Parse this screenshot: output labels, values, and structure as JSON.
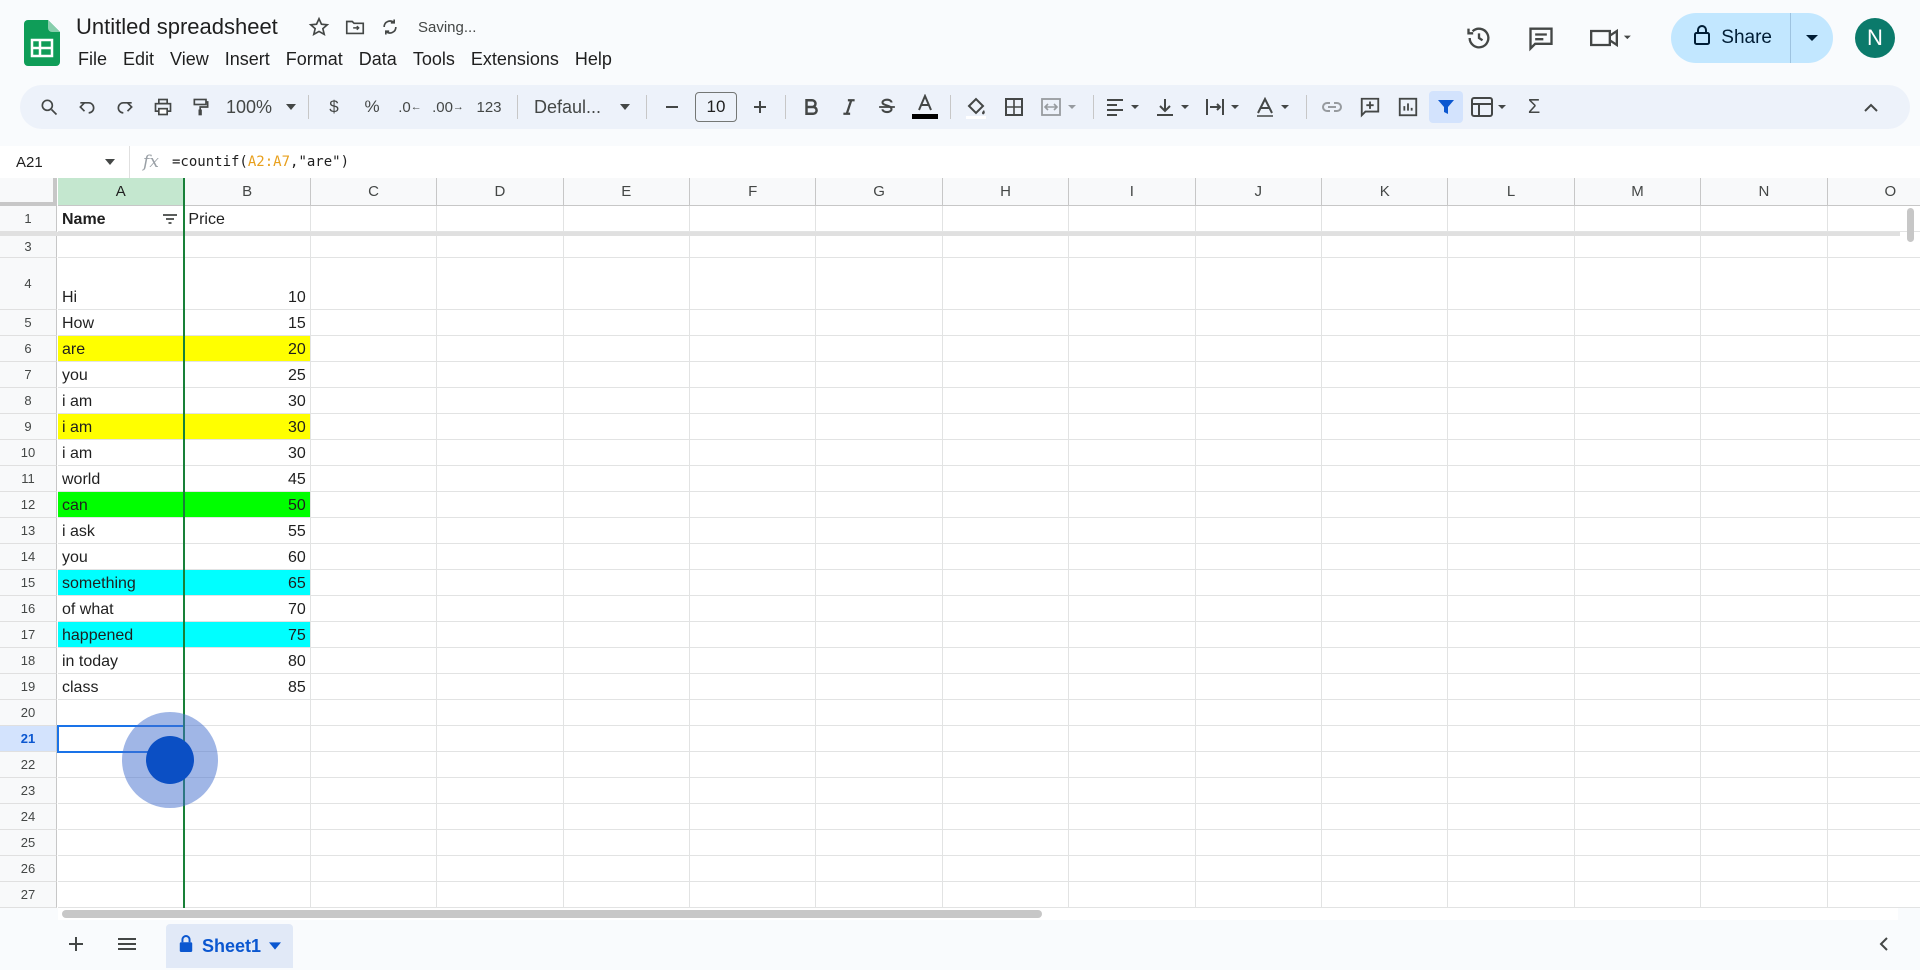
{
  "app": {
    "title": "Untitled spreadsheet",
    "status": "Saving...",
    "avatar_letter": "N",
    "share_label": "Share"
  },
  "menu": [
    "File",
    "Edit",
    "View",
    "Insert",
    "Format",
    "Data",
    "Tools",
    "Extensions",
    "Help"
  ],
  "toolbar": {
    "zoom": "100%",
    "currency": "$",
    "percent": "%",
    "dec_minus": ".0",
    "dec_plus": ".00",
    "format_num": "123",
    "font": "Defaul...",
    "font_size": "10"
  },
  "formula_bar": {
    "cell_ref": "A21",
    "formula_prefix": "=countif(",
    "formula_range": "A2:A7",
    "formula_suffix": ",\"are\")"
  },
  "columns": [
    "A",
    "B",
    "C",
    "D",
    "E",
    "F",
    "G",
    "H",
    "I",
    "J",
    "K",
    "L",
    "M",
    "N",
    "O"
  ],
  "header_row": {
    "num": "1",
    "a": "Name",
    "b": "Price"
  },
  "rows": [
    {
      "num": "3",
      "a": "",
      "b": "",
      "bg": ""
    },
    {
      "num": "4",
      "a": "Hi",
      "b": "10",
      "bg": ""
    },
    {
      "num": "5",
      "a": "How",
      "b": "15",
      "bg": ""
    },
    {
      "num": "6",
      "a": "are",
      "b": "20",
      "bg": "#ffff00"
    },
    {
      "num": "7",
      "a": "you",
      "b": "25",
      "bg": ""
    },
    {
      "num": "8",
      "a": "i am",
      "b": "30",
      "bg": ""
    },
    {
      "num": "9",
      "a": "i am",
      "b": "30",
      "bg": "#ffff00"
    },
    {
      "num": "10",
      "a": "i am",
      "b": "30",
      "bg": ""
    },
    {
      "num": "11",
      "a": "world",
      "b": "45",
      "bg": ""
    },
    {
      "num": "12",
      "a": "can",
      "b": "50",
      "bg": "#00ff00"
    },
    {
      "num": "13",
      "a": "i ask",
      "b": "55",
      "bg": ""
    },
    {
      "num": "14",
      "a": "you",
      "b": "60",
      "bg": ""
    },
    {
      "num": "15",
      "a": "something",
      "b": "65",
      "bg": "#00ffff"
    },
    {
      "num": "16",
      "a": "of what",
      "b": "70",
      "bg": ""
    },
    {
      "num": "17",
      "a": "happened",
      "b": "75",
      "bg": "#00ffff"
    },
    {
      "num": "18",
      "a": "in today",
      "b": "80",
      "bg": ""
    },
    {
      "num": "19",
      "a": "class",
      "b": "85",
      "bg": ""
    },
    {
      "num": "20",
      "a": "",
      "b": "",
      "bg": ""
    },
    {
      "num": "21",
      "a": "",
      "b": "",
      "bg": ""
    },
    {
      "num": "22",
      "a": "",
      "b": "",
      "bg": ""
    },
    {
      "num": "23",
      "a": "",
      "b": "",
      "bg": ""
    },
    {
      "num": "24",
      "a": "",
      "b": "",
      "bg": ""
    },
    {
      "num": "25",
      "a": "",
      "b": "",
      "bg": ""
    },
    {
      "num": "26",
      "a": "",
      "b": "",
      "bg": ""
    },
    {
      "num": "27",
      "a": "",
      "b": "",
      "bg": ""
    }
  ],
  "selected_row": "21",
  "sheet": {
    "name": "Sheet1"
  }
}
